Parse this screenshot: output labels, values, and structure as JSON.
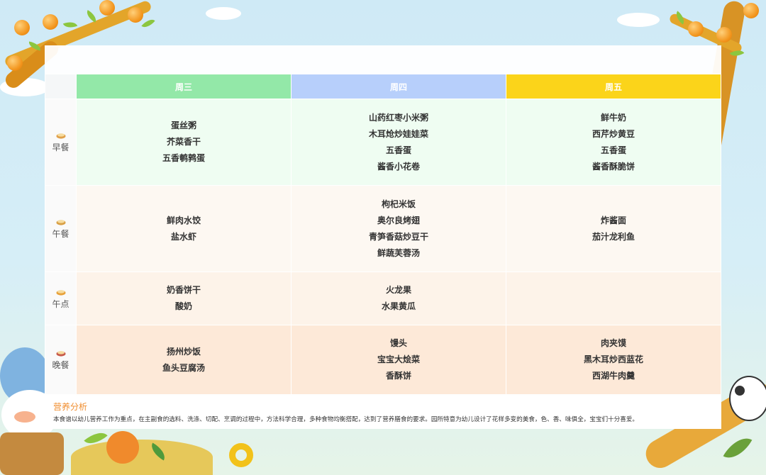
{
  "header": {
    "title": ""
  },
  "days": [
    "周三",
    "周四",
    "周五"
  ],
  "meals": [
    {
      "name": "早餐",
      "icon": "bun-icon",
      "items": [
        [
          "蛋丝粥",
          "芥菜香干",
          "五香鹌鹑蛋"
        ],
        [
          "山药红枣小米粥",
          "木耳炝炒娃娃菜",
          "五香蛋",
          "酱香小花卷"
        ],
        [
          "鲜牛奶",
          "西芹炒黄豆",
          "五香蛋",
          "酱香酥脆饼"
        ]
      ]
    },
    {
      "name": "午餐",
      "icon": "bowl-icon",
      "items": [
        [
          "鲜肉水饺",
          "盐水虾"
        ],
        [
          "枸杞米饭",
          "奥尔良烤翅",
          "青笋香菇炒豆干",
          "鲜蔬芙蓉汤"
        ],
        [
          "炸酱面",
          "茄汁龙利鱼"
        ]
      ]
    },
    {
      "name": "午点",
      "icon": "snack-icon",
      "items": [
        [
          "奶香饼干",
          "酸奶"
        ],
        [
          "火龙果",
          "水果黄瓜"
        ],
        []
      ]
    },
    {
      "name": "晚餐",
      "icon": "dish-icon",
      "items": [
        [
          "扬州炒饭",
          "鱼头豆腐汤"
        ],
        [
          "馒头",
          "宝宝大烩菜",
          "香酥饼"
        ],
        [
          "肉夹馍",
          "黑木耳炒西蓝花",
          "西湖牛肉羹"
        ]
      ]
    }
  ],
  "nutrition": {
    "title": "营养分析",
    "text": "本食谱以幼儿营养工作为重点，在主副食的选料、洗涤、切配、烹调的过程中，方法科学合理，多种食物均衡搭配，达到了营养膳食的要求。园所特意为幼儿设计了花样多变的美食，色、香、味俱全，宝宝们十分喜爱。"
  },
  "colors": {
    "wed": "#93e8a8",
    "thu": "#b7cffb",
    "fri": "#fbd41a",
    "accent": "#f08d2e"
  }
}
